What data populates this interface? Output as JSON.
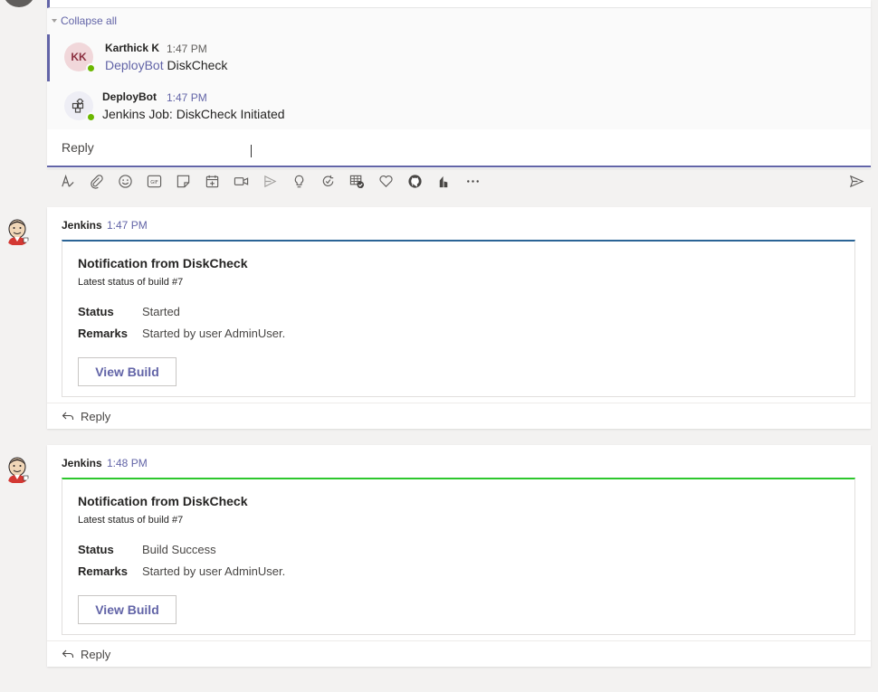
{
  "thread": {
    "collapse_label": "Collapse all",
    "messages": [
      {
        "avatar_initials": "KK",
        "author": "Karthick K",
        "time": "1:47 PM",
        "mention": "DeployBot",
        "text": "DiskCheck"
      },
      {
        "author": "DeployBot",
        "time": "1:47 PM",
        "text": "Jenkins Job: DiskCheck Initiated"
      }
    ],
    "reply_placeholder": "Reply"
  },
  "toolbar": {
    "icons": [
      "format-icon",
      "attach-icon",
      "emoji-icon",
      "gif-icon",
      "sticker-icon",
      "schedule-meeting-icon",
      "meet-now-icon",
      "stream-icon",
      "praise-icon",
      "loop-icon",
      "planner-icon",
      "like-icon",
      "github-icon",
      "power-bi-icon",
      "more-options-icon",
      "send-icon"
    ]
  },
  "posts": [
    {
      "sender": "Jenkins",
      "time": "1:47 PM",
      "card": {
        "accent": "#2a6496",
        "title": "Notification from DiskCheck",
        "subtitle": "Latest status of build #7",
        "status_label": "Status",
        "status_value": "Started",
        "remarks_label": "Remarks",
        "remarks_value": "Started by user AdminUser.",
        "button_label": "View Build"
      },
      "reply_label": "Reply"
    },
    {
      "sender": "Jenkins",
      "time": "1:48 PM",
      "card": {
        "accent": "#2dc72d",
        "title": "Notification from DiskCheck",
        "subtitle": "Latest status of build #7",
        "status_label": "Status",
        "status_value": "Build Success",
        "remarks_label": "Remarks",
        "remarks_value": "Started by user AdminUser.",
        "button_label": "View Build"
      },
      "reply_label": "Reply"
    }
  ],
  "colors": {
    "brand": "#6264a7",
    "presence": "#6bb700"
  }
}
